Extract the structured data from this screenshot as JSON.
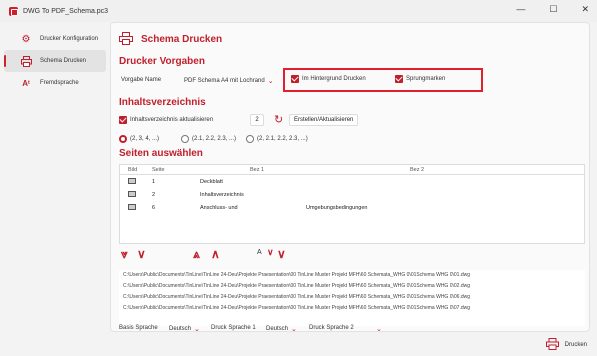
{
  "window": {
    "title": "DWG To PDF_Schema.pc3",
    "minimize": "—",
    "maximize": "☐",
    "close": "✕"
  },
  "sidebar": {
    "items": [
      {
        "label": "Drucker Konfiguration",
        "icon": "gear-icon"
      },
      {
        "label": "Schema Drucken",
        "icon": "printer-icon"
      },
      {
        "label": "Fremdsprache",
        "icon": "translate-icon"
      }
    ]
  },
  "main": {
    "title": "Schema Drucken",
    "drucker_vorgaben": {
      "heading": "Drucker Vorgaben",
      "vorgabe_label": "Vorgabe Name",
      "vorgabe_value": "PDF Schema A4 mit Lochrand",
      "hintergrund_label": "Im Hintergrund Drucken",
      "sprungmarken_label": "Sprungmarken"
    },
    "inhaltsverzeichnis": {
      "heading": "Inhaltsverzeichnis",
      "aktualisieren_label": "Inhaltsverzeichnis aktualisieren",
      "count_value": "2",
      "erstellen_label": "Erstellen/Aktualisieren",
      "radio_options": [
        "(2, 3, 4, ...)",
        "(2.1, 2.2, 2.3, ...)",
        "(2, 2.1, 2.2, 2.3, ...)"
      ]
    },
    "seiten": {
      "heading": "Seiten auswählen",
      "columns": [
        "Bild",
        "Seite",
        "Bez 1",
        "Bez 2"
      ],
      "rows": [
        {
          "seite": "1",
          "bez1": "Deckblatt",
          "bez2": ""
        },
        {
          "seite": "2",
          "bez1": "Inhaltsverzeichnis",
          "bez2": ""
        },
        {
          "seite": "6",
          "bez1": "Anschluss- und",
          "bez2": "Umgebungsbedingungen"
        }
      ]
    },
    "files": [
      "C:\\Users\\Public\\Documents\\TinLine\\TinLine 24-Deu\\Projekte Praesentation\\00 TinLine Muster Projekt MFH\\60 Schemata_WHG 0\\01Schema WHG 0\\01.dwg",
      "C:\\Users\\Public\\Documents\\TinLine\\TinLine 24-Deu\\Projekte Praesentation\\00 TinLine Muster Projekt MFH\\60 Schemata_WHG 0\\01Schema WHG 0\\02.dwg",
      "C:\\Users\\Public\\Documents\\TinLine\\TinLine 24-Deu\\Projekte Praesentation\\00 TinLine Muster Projekt MFH\\60 Schemata_WHG 0\\01Schema WHG 0\\06.dwg",
      "C:\\Users\\Public\\Documents\\TinLine\\TinLine 24-Deu\\Projekte Praesentation\\00 TinLine Muster Projekt MFH\\60 Schemata_WHG 0\\01Schema WHG 0\\07.dwg"
    ],
    "sprache": {
      "basis_label": "Basis Sprache",
      "basis_value": "Deutsch",
      "druck1_label": "Druck Sprache 1",
      "druck1_value": "Deutsch",
      "druck2_label": "Druck Sprache 2",
      "druck2_value": ""
    }
  },
  "footer": {
    "drucken_label": "Drucken"
  },
  "colors": {
    "accent": "#c0202c",
    "highlight_box": "#e0202c"
  }
}
